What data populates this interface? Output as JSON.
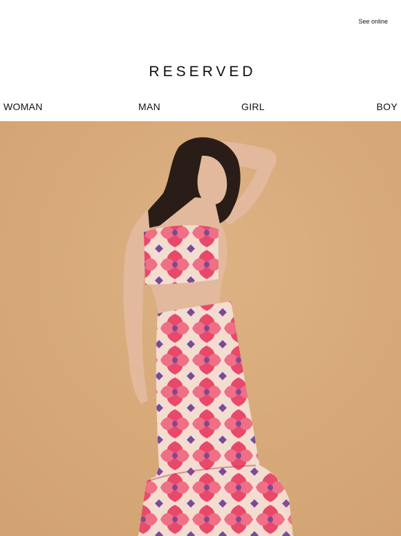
{
  "header": {
    "see_online_label": "See online",
    "logo_text": "RESERVED"
  },
  "nav": {
    "items": [
      {
        "label": "WOMAN"
      },
      {
        "label": "MAN"
      },
      {
        "label": "GIRL"
      },
      {
        "label": "BOY"
      }
    ]
  },
  "hero": {
    "colors": {
      "background": "#d9ab7b",
      "print_primary": "#e8496a",
      "print_secondary": "#f6e6da",
      "print_accent": "#7a4a9a",
      "hair": "#2a1d18",
      "skin": "#e2b99c"
    }
  }
}
